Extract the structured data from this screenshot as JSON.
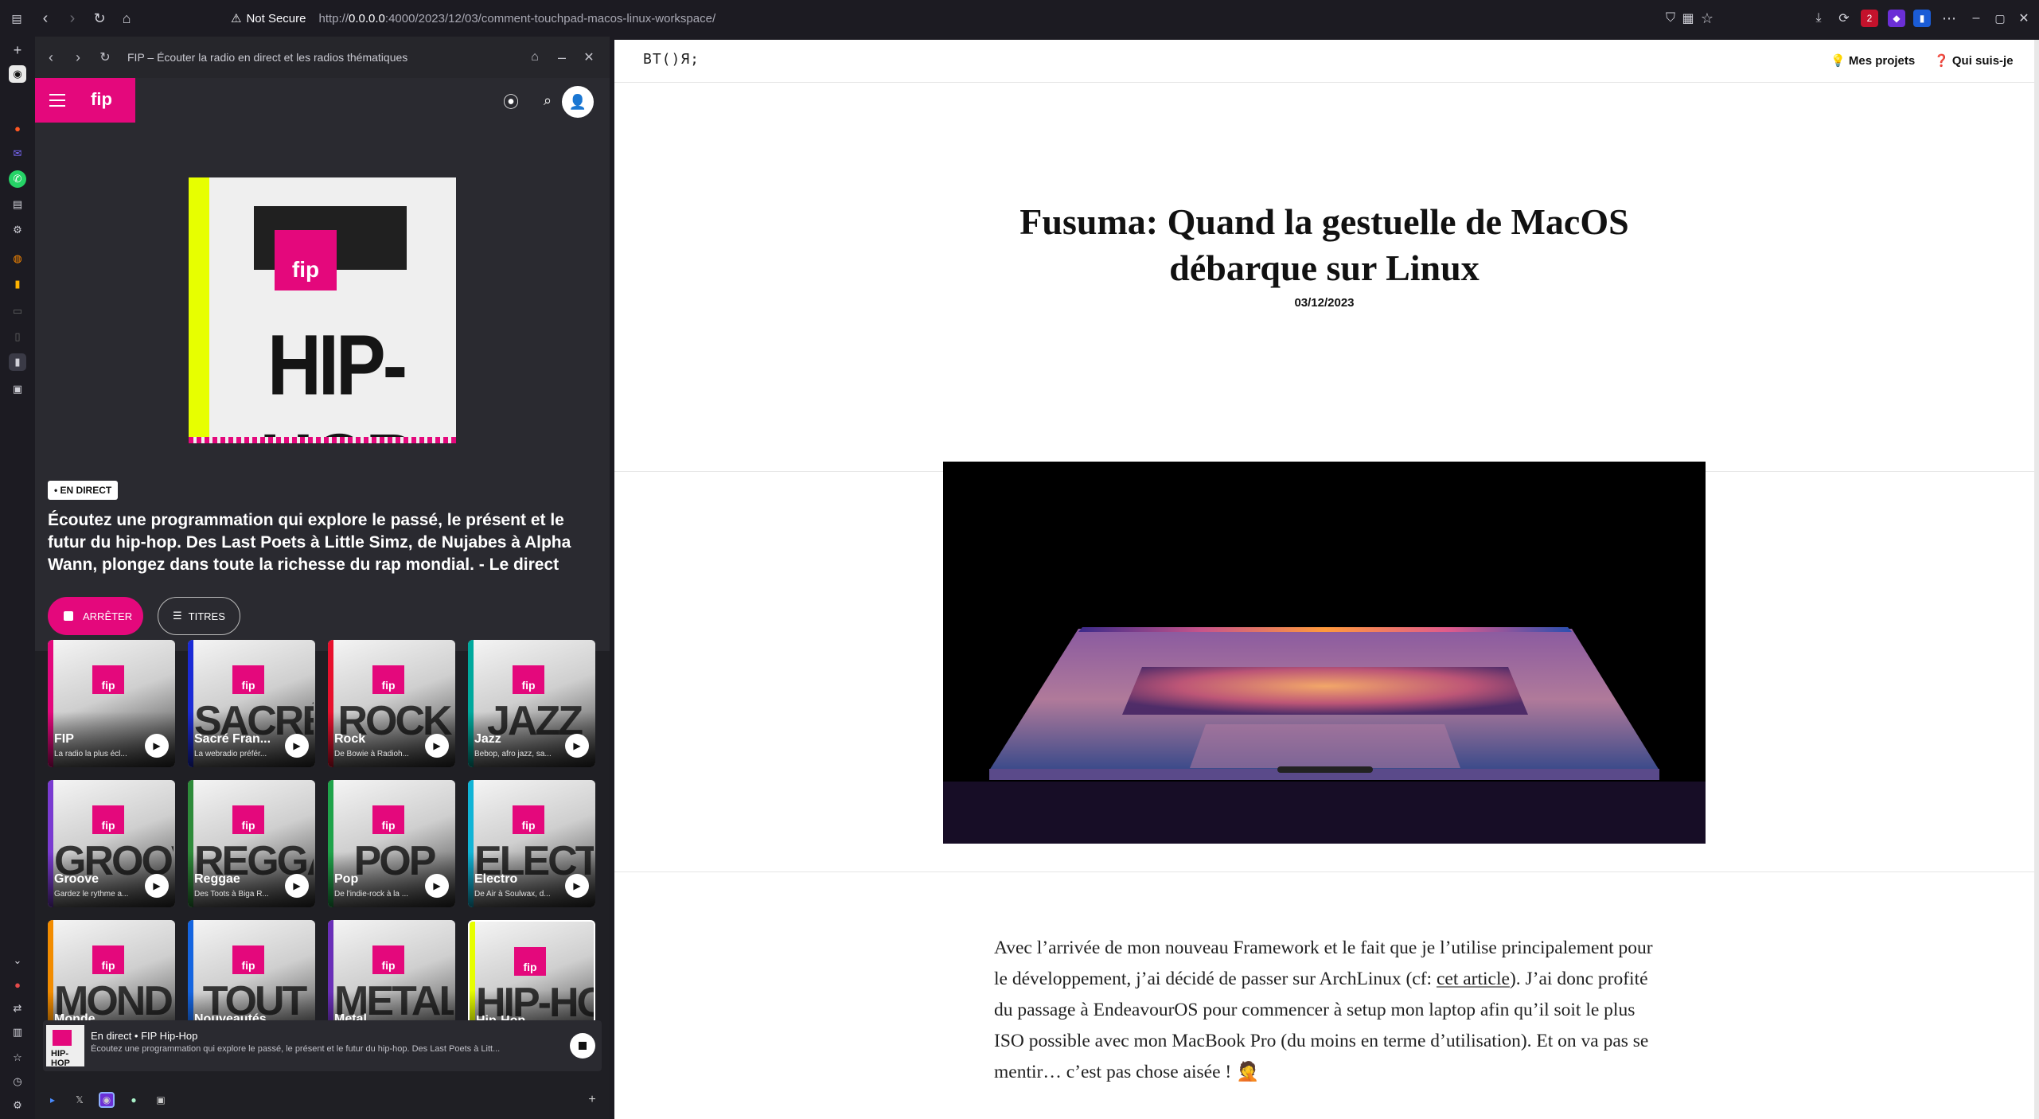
{
  "browser": {
    "security_label": "Not Secure",
    "url_prefix": "http://",
    "url_host": "0.0.0.0",
    "url_path": ":4000/2023/12/03/comment-touchpad-macos-linux-workspace/",
    "ext_badge": "2"
  },
  "panel": {
    "title": "FIP – Écouter la radio en direct et les radios thématiques"
  },
  "fip": {
    "logo_text": "fip",
    "cover": {
      "badge": "fip",
      "text": "HIP-HOP"
    },
    "live_badge": "• EN DIRECT",
    "description": "Écoutez une programmation qui explore le passé, le présent et le futur du hip-hop. Des Last Poets à Little Simz, de Nujabes à Alpha Wann, plongez dans toute la richesse du rap mondial. - Le direct",
    "stop_label": "ARRÊTER",
    "titles_label": "TITRES",
    "stations": [
      {
        "name": "FIP",
        "sub": "La radio la plus écl...",
        "art": "",
        "color": "#e4087c"
      },
      {
        "name": "Sacré Fran...",
        "sub": "La webradio préfér...",
        "art": "SACRÉ",
        "color": "#1b2bd6"
      },
      {
        "name": "Rock",
        "sub": "De Bowie à Radioh...",
        "art": "ROCK",
        "color": "#e8112d"
      },
      {
        "name": "Jazz",
        "sub": "Bebop, afro jazz, sa...",
        "art": "JAZZ",
        "color": "#00a99d"
      },
      {
        "name": "Groove",
        "sub": "Gardez le rythme a...",
        "art": "GROOVE",
        "color": "#7a3bd1"
      },
      {
        "name": "Reggae",
        "sub": "Des Toots à Biga R...",
        "art": "REGGAE",
        "color": "#2e8b3a"
      },
      {
        "name": "Pop",
        "sub": "De l'indie-rock à la ...",
        "art": "POP",
        "color": "#1fa34a"
      },
      {
        "name": "Electro",
        "sub": "De Air à Soulwax, d...",
        "art": "ELECTRO",
        "color": "#11b4d6"
      },
      {
        "name": "Monde",
        "sub": "",
        "art": "MONDE",
        "color": "#f28c00"
      },
      {
        "name": "Nouveautés",
        "sub": "",
        "art": "TOUT",
        "color": "#1565e0"
      },
      {
        "name": "Metal",
        "sub": "",
        "art": "METAL",
        "color": "#6a2fb8"
      },
      {
        "name": "Hip-Hop",
        "sub": "",
        "art": "HIP-HOP",
        "color": "#e7ff00"
      }
    ],
    "mini_player": {
      "line1": "En direct • FIP Hip-Hop",
      "line2": "Écoutez une programmation qui explore le passé, le présent et le futur du hip-hop. Des Last Poets à Litt...",
      "cover_text": "HIP-HOP"
    }
  },
  "site": {
    "logo": "BT()Я;",
    "nav": {
      "projects": "Mes projets",
      "about": "Qui suis-je",
      "projects_icon": "💡",
      "about_icon": "❓"
    },
    "post": {
      "title": "Fusuma: Quand la gestuelle de MacOS débarque sur Linux",
      "date": "03/12/2023",
      "para_before_link": "Avec l’arrivée de mon nouveau Framework et le fait que je l’utilise principalement pour le développement, j’ai décidé de passer sur ArchLinux (cf: ",
      "link_text": "cet article",
      "para_after_link": "). J’ai donc profité du passage à EndeavourOS pour commencer à setup mon laptop afin qu’il soit le plus ISO possible avec mon MacBook Pro (du moins en terme d’utilisation). Et on va pas se mentir… c’est pas chose aisée !",
      "emoji": "🤦"
    }
  },
  "colors": {
    "fip_pink": "#e4087c",
    "hiphop_yellow": "#e7ff00",
    "browser_bg": "#1c1b22"
  }
}
